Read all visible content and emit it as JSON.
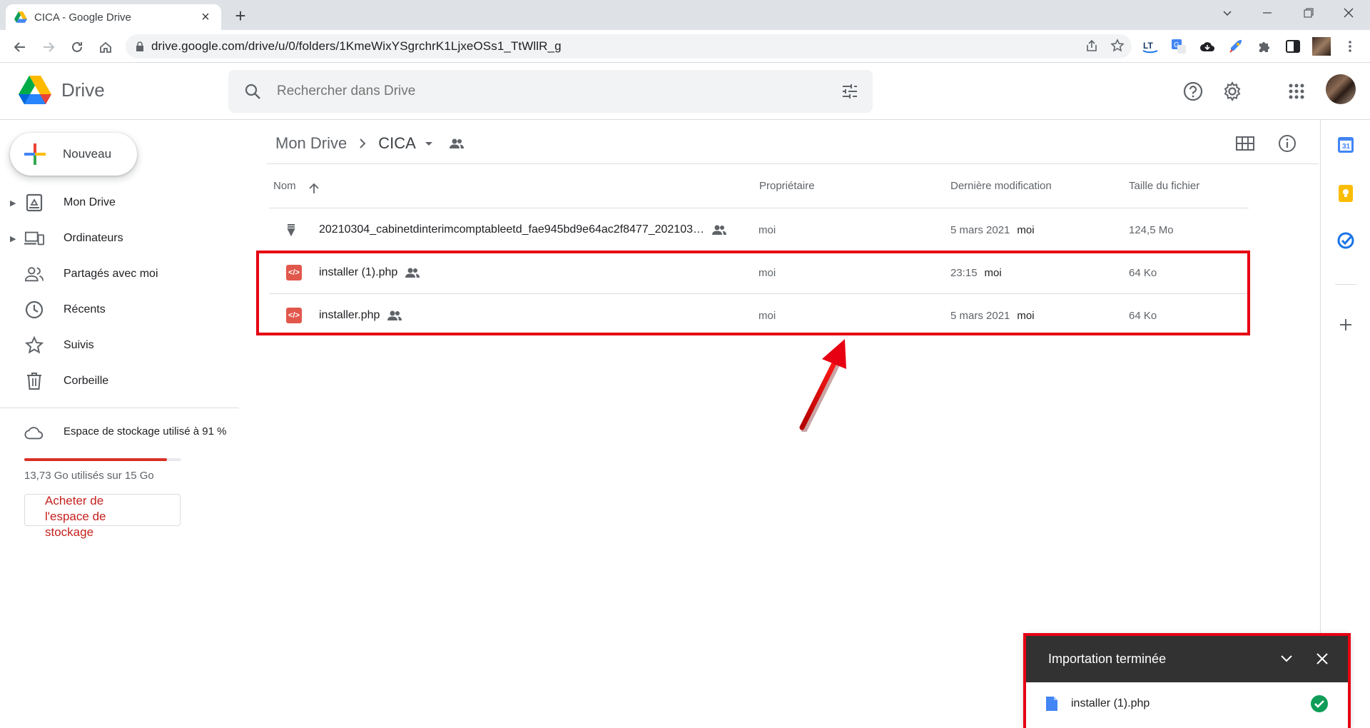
{
  "browser": {
    "tab_title": "CICA - Google Drive",
    "new_tab_label": "+",
    "url": "drive.google.com/drive/u/0/folders/1KmeWixYSgrchrK1LjxeOSs1_TtWllR_g"
  },
  "header": {
    "app_name": "Drive",
    "search_placeholder": "Rechercher dans Drive"
  },
  "sidebar": {
    "new_label": "Nouveau",
    "items": [
      {
        "label": "Mon Drive"
      },
      {
        "label": "Ordinateurs"
      },
      {
        "label": "Partagés avec moi"
      },
      {
        "label": "Récents"
      },
      {
        "label": "Suivis"
      },
      {
        "label": "Corbeille"
      }
    ],
    "storage": {
      "label": "Espace de stockage utilisé à 91 %",
      "used_fraction": 0.91,
      "usage_text": "13,73 Go utilisés sur 15 Go",
      "buy_label": "Acheter de l'espace de stockage"
    }
  },
  "breadcrumb": {
    "root": "Mon Drive",
    "current": "CICA"
  },
  "table": {
    "headers": {
      "name": "Nom",
      "owner": "Propriétaire",
      "modified": "Dernière modification",
      "size": "Taille du fichier"
    },
    "rows": [
      {
        "name": "20210304_cabinetdinterimcomptableetd_fae945bd9e64ac2f8477_202103…",
        "owner": "moi",
        "modified_date": "5 mars 2021",
        "modified_by": "moi",
        "size": "124,5 Mo",
        "type": "archive"
      },
      {
        "name": "installer (1).php",
        "owner": "moi",
        "modified_date": "23:15",
        "modified_by": "moi",
        "size": "64 Ko",
        "type": "php"
      },
      {
        "name": "installer.php",
        "owner": "moi",
        "modified_date": "5 mars 2021",
        "modified_by": "moi",
        "size": "64 Ko",
        "type": "php"
      }
    ]
  },
  "upload": {
    "title": "Importation terminée",
    "file": "installer (1).php"
  },
  "colors": {
    "highlight": "#e60012",
    "accent_blue": "#1a73e8",
    "storage_red": "#d93025"
  }
}
